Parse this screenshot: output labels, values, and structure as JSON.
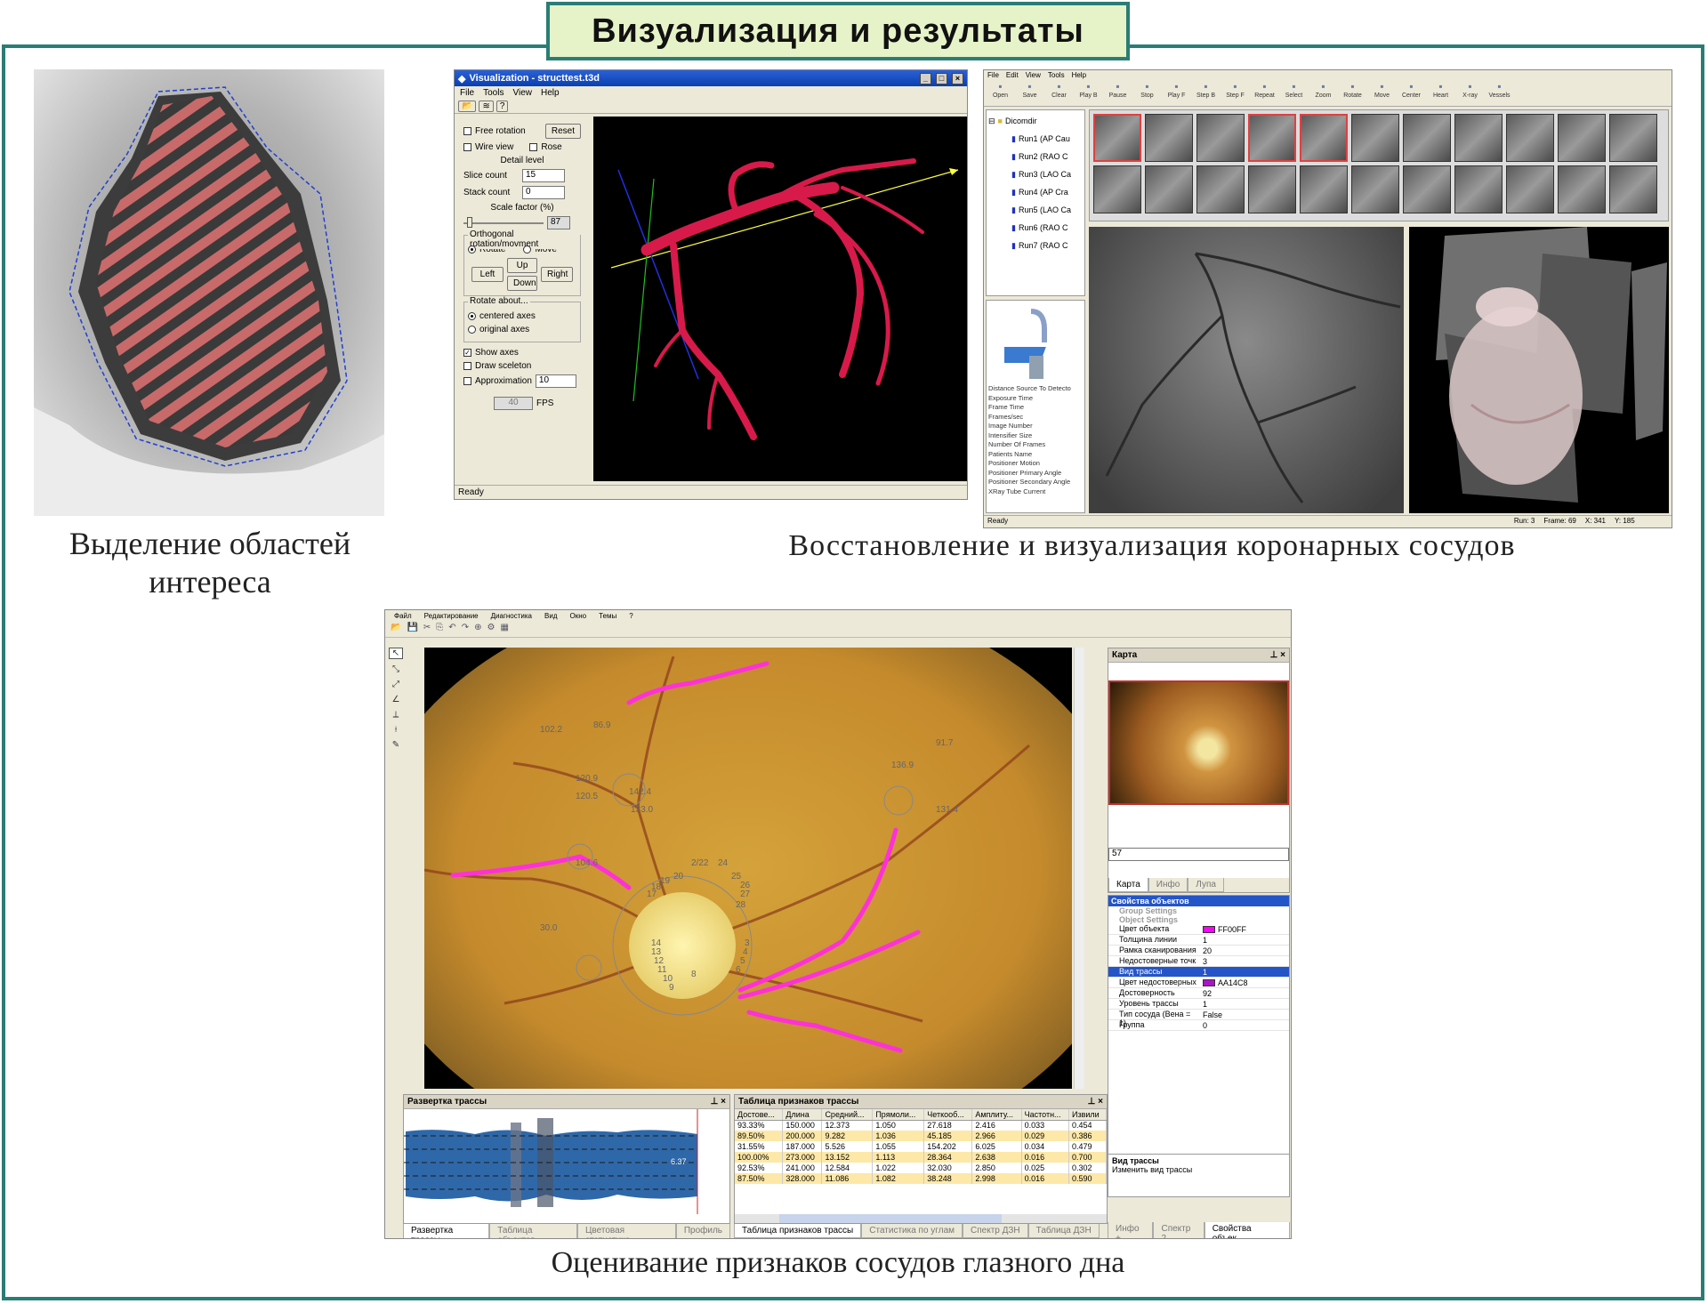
{
  "banner": {
    "title": "Визуализация и результаты"
  },
  "captions": {
    "roi": "Выделение областей интереса",
    "coronary": "Восстановление и визуализация коронарных сосудов",
    "fundus": "Оценивание признаков сосудов глазного дна"
  },
  "vis_window": {
    "title": "Visualization - structtest.t3d",
    "menu": [
      "File",
      "Tools",
      "View",
      "Help"
    ],
    "free_rotation": "Free rotation",
    "reset": "Reset",
    "wire_view": "Wire view",
    "rose": "Rose",
    "detail_level": "Detail level",
    "slice_count_label": "Slice count",
    "slice_count": "15",
    "stack_count_label": "Stack count",
    "stack_count": "0",
    "scale_factor_label": "Scale factor (%)",
    "scale_factor": "87",
    "scale_slider_level": 0.05,
    "orthogonal_group": "Orthogonal rotation/movment",
    "rotate": "Rotate",
    "move": "Move",
    "up": "Up",
    "left": "Left",
    "right": "Right",
    "down": "Down",
    "rotate_about_group": "Rotate about...",
    "centered_axes": "centered axes",
    "original_axes": "original axes",
    "show_axes": "Show axes",
    "draw_sceleton": "Draw sceleton",
    "approximation": "Approximation",
    "approximation_value": "10",
    "fps_value": "40",
    "fps_label": "FPS",
    "status": "Ready"
  },
  "angio_window": {
    "menu": [
      "File",
      "Edit",
      "View",
      "Tools",
      "Help"
    ],
    "toolbar": [
      "Open",
      "Save",
      "Clear",
      "Play B",
      "Pause",
      "Stop",
      "Play F",
      "Step B",
      "Step F",
      "Repeat",
      "Select",
      "Zoom",
      "Rotate",
      "Move",
      "Center",
      "Heart",
      "X-ray",
      "Vessels"
    ],
    "tree_root": "Dicomdir",
    "runs": [
      "Run1 (AP Cau",
      "Run2 (RAO C",
      "Run3 (LAO Ca",
      "Run4 (AP Cra",
      "Run5 (LAO Ca",
      "Run6 (RAO C",
      "Run7 (RAO C"
    ],
    "props": [
      "Distance Source To Detecto",
      "Exposure Time",
      "Frame Time",
      "Frames/sec",
      "Image Number",
      "Intensifier Size",
      "Number Of Frames",
      "Patients Name",
      "Positioner Motion",
      "Positioner Primary Angle",
      "Positioner Secondary Angle",
      "XRay Tube Current"
    ],
    "status_ready": "Ready",
    "status_run": "Run:   3",
    "status_frame": "Frame:  69",
    "status_x": "X: 341",
    "status_y": "Y: 185"
  },
  "fundus_window": {
    "menu": [
      "Файл",
      "Редактирование",
      "Диагностика",
      "Вид",
      "Окно",
      "Темы",
      "?"
    ],
    "map_title": "Карта",
    "map_value": "57",
    "map_tabs": [
      "Карта",
      "Инфо",
      "Лупа"
    ],
    "props_title": "Свойства объектов",
    "group_settings": "Group Settings",
    "object_settings": "Object Settings",
    "props": [
      {
        "k": "Цвет объекта",
        "v": "FF00FF",
        "swatch": "#ff00ff"
      },
      {
        "k": "Толщина линии",
        "v": "1"
      },
      {
        "k": "Рамка сканирования",
        "v": "20"
      },
      {
        "k": "Недостоверные точк",
        "v": "3"
      },
      {
        "k": "Вид трассы",
        "v": "1",
        "selected": true
      },
      {
        "k": "Цвет недостоверных",
        "v": "AA14C8",
        "swatch": "#aa14c8"
      },
      {
        "k": "Достоверность",
        "v": "92"
      },
      {
        "k": "Уровень трассы",
        "v": "1"
      },
      {
        "k": "Тип сосуда (Вена = 1)",
        "v": "False"
      },
      {
        "k": "Группа",
        "v": "0"
      }
    ],
    "help_title": "Вид трассы",
    "help_text": "Изменить вид трассы",
    "right_tabs": [
      "Инфо +",
      "Спектр 2",
      "Свойства объек..."
    ],
    "trace_title": "Развертка трассы",
    "trace_marker": "6.37",
    "trace_tabs": [
      "Развертка трассы",
      "Таблица объектов",
      "Цветовая статистика",
      "Профиль"
    ],
    "table_title": "Таблица признаков трассы",
    "table_headers": [
      "Достове...",
      "Длина",
      "Средний...",
      "Прямоли...",
      "Четкооб...",
      "Амплиту...",
      "Частотн...",
      "Извили"
    ],
    "table_rows": [
      [
        "93.33%",
        "150.000",
        "12.373",
        "1.050",
        "27.618",
        "2.416",
        "0.033",
        "0.454"
      ],
      [
        "89.50%",
        "200.000",
        "9.282",
        "1.036",
        "45.185",
        "2.966",
        "0.029",
        "0.386"
      ],
      [
        "31.55%",
        "187.000",
        "5.526",
        "1.055",
        "154.202",
        "6.025",
        "0.034",
        "0.479"
      ],
      [
        "100.00%",
        "273.000",
        "13.152",
        "1.113",
        "28.364",
        "2.638",
        "0.016",
        "0.700"
      ],
      [
        "92.53%",
        "241.000",
        "12.584",
        "1.022",
        "32.030",
        "2.850",
        "0.025",
        "0.302"
      ],
      [
        "87.50%",
        "328.000",
        "11.086",
        "1.082",
        "38.248",
        "2.998",
        "0.016",
        "0.590"
      ]
    ],
    "table_tabs": [
      "Таблица признаков трассы",
      "Статистика по углам",
      "Спектр ДЗН",
      "Таблица ДЗН"
    ],
    "fundus_labels": [
      "102.2",
      "86.9",
      "120.9",
      "120.5",
      "142.4",
      "133.0",
      "104.6",
      "136.9",
      "91.7",
      "131.4",
      "30.0",
      "20",
      "19",
      "18",
      "17",
      "2/22",
      "24",
      "25",
      "26",
      "27",
      "28",
      "14",
      "13",
      "12",
      "11",
      "10",
      "9",
      "8",
      "6",
      "5",
      "4",
      "3"
    ]
  }
}
